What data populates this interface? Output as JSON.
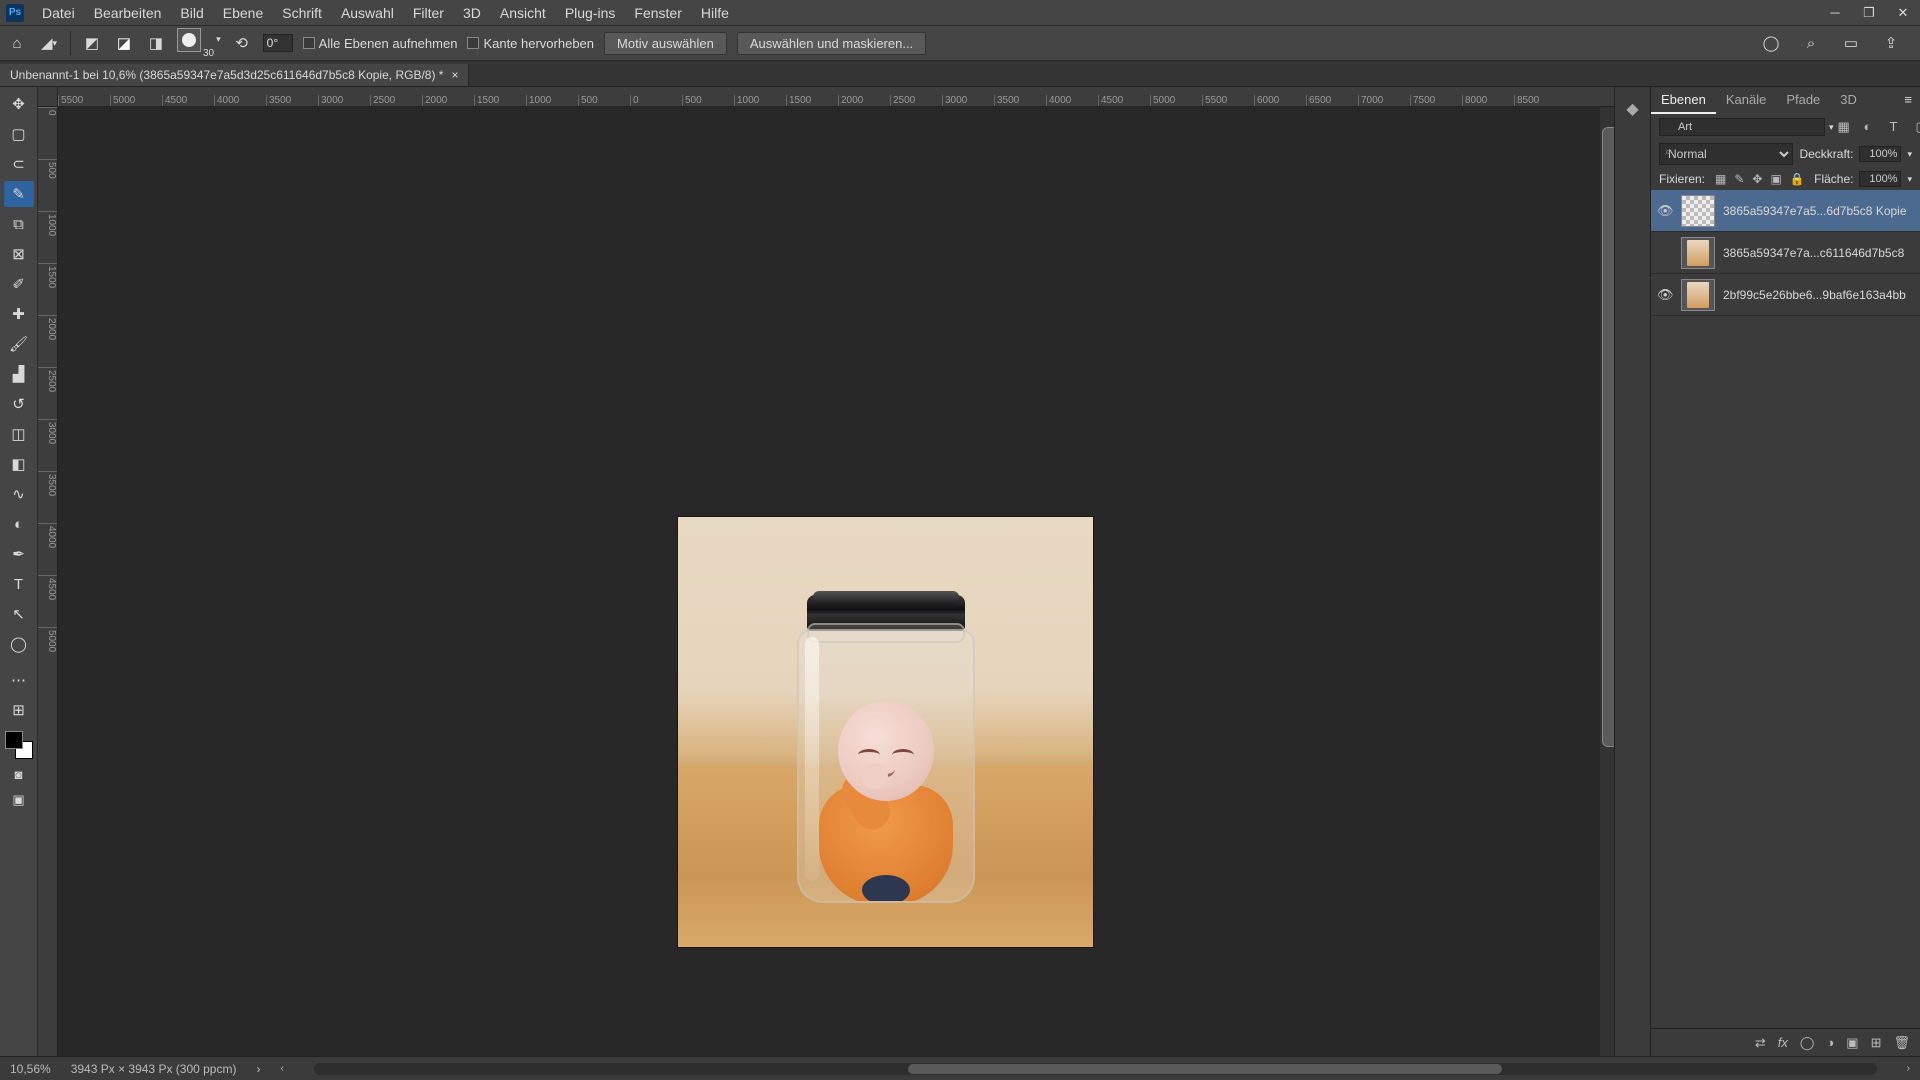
{
  "menubar": [
    "Datei",
    "Bearbeiten",
    "Bild",
    "Ebene",
    "Schrift",
    "Auswahl",
    "Filter",
    "3D",
    "Ansicht",
    "Plug-ins",
    "Fenster",
    "Hilfe"
  ],
  "options": {
    "brush_size": "30",
    "rotation": "0°",
    "cb1": "Alle Ebenen aufnehmen",
    "cb2": "Kante hervorheben",
    "btn1": "Motiv auswählen",
    "btn2": "Auswählen und maskieren..."
  },
  "doc": {
    "title": "Unbenannt-1 bei 10,6% (3865a59347e7a5d3d25c611646d7b5c8 Kopie, RGB/8) *"
  },
  "hruler": [
    "5500",
    "5000",
    "4500",
    "4000",
    "3500",
    "3000",
    "2500",
    "2000",
    "1500",
    "1000",
    "500",
    "0",
    "500",
    "1000",
    "1500",
    "2000",
    "2500",
    "3000",
    "3500",
    "4000",
    "4500",
    "5000",
    "5500",
    "6000",
    "6500",
    "7000",
    "7500",
    "8000",
    "8500"
  ],
  "vruler": [
    "0",
    "500",
    "1000",
    "1500",
    "2000",
    "2500",
    "3000",
    "3500",
    "4000",
    "4500",
    "5000"
  ],
  "panel": {
    "tabs": [
      "Ebenen",
      "Kanäle",
      "Pfade",
      "3D"
    ],
    "search_label": "Art",
    "blend": "Normal",
    "opacity_label": "Deckkraft:",
    "opacity_val": "100%",
    "lock_label": "Fixieren:",
    "fill_label": "Fläche:",
    "fill_val": "100%"
  },
  "layers": [
    {
      "name": "3865a59347e7a5...6d7b5c8 Kopie",
      "visible": true,
      "checker": true,
      "selected": true
    },
    {
      "name": "3865a59347e7a...c611646d7b5c8",
      "visible": false,
      "checker": false,
      "selected": false
    },
    {
      "name": "2bf99c5e26bbe6...9baf6e163a4bb",
      "visible": true,
      "checker": false,
      "selected": false
    }
  ],
  "status": {
    "zoom": "10,56%",
    "docinfo": "3943 Px × 3943 Px (300 ppcm)"
  }
}
